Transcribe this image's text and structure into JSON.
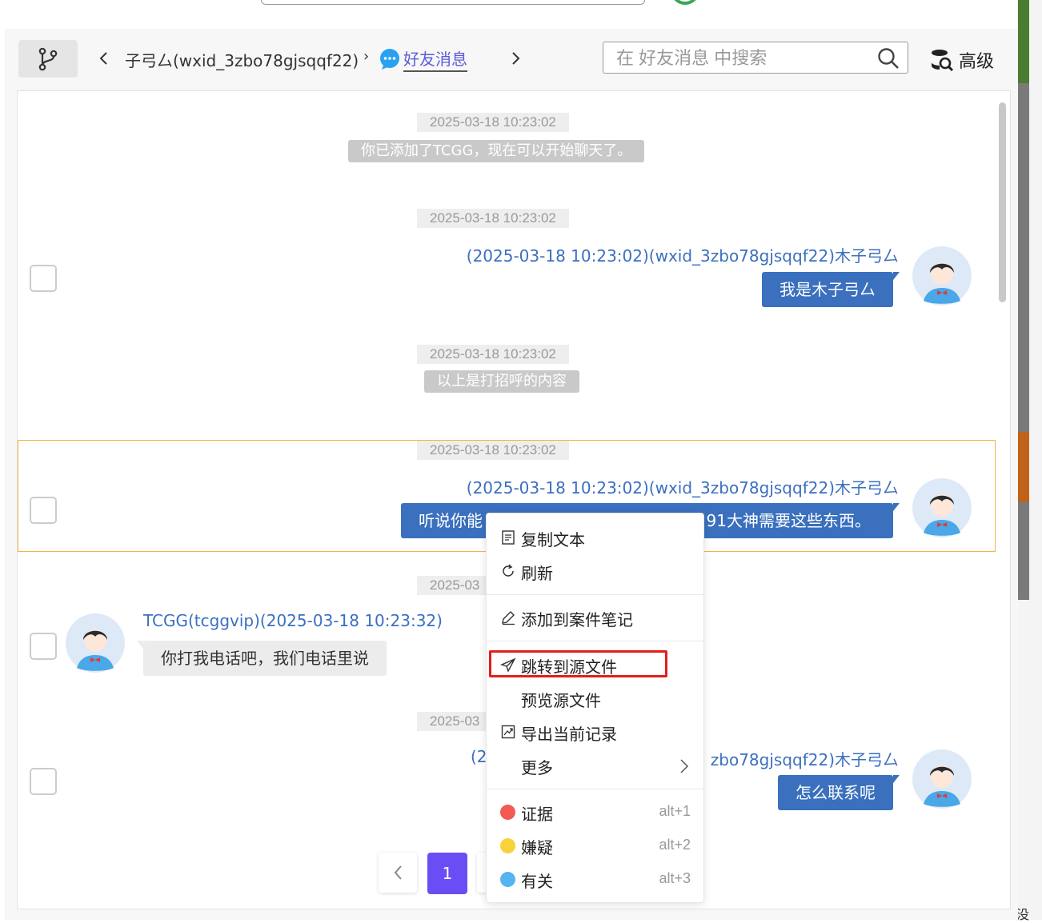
{
  "window": {
    "accent_color": "#6b4df5",
    "highlight_color": "#e51c1c"
  },
  "toolbar": {
    "branch_icon": "branch-icon",
    "breadcrumb_contact": "子弓厶(wxid_3zbo78gjsqqf22)",
    "breadcrumb_separator": "›",
    "breadcrumb_current": "好友消息",
    "search_placeholder": "在 好友消息 中搜索",
    "search_value": "",
    "advanced_label": "高级"
  },
  "messages": [
    {
      "type": "system",
      "time": "2025-03-18 10:23:02",
      "text": "你已添加了TCGG，现在可以开始聊天了。"
    },
    {
      "type": "outgoing",
      "time": "2025-03-18 10:23:02",
      "sender": "(2025-03-18 10:23:02)(wxid_3zbo78gjsqqf22)木子弓厶",
      "text": "我是木子弓厶"
    },
    {
      "type": "system",
      "time": "2025-03-18 10:23:02",
      "text": "以上是打招呼的内容"
    },
    {
      "type": "outgoing",
      "time": "2025-03-18 10:23:02",
      "sender": "(2025-03-18 10:23:02)(wxid_3zbo78gjsqqf22)木子弓厶",
      "text_left": "听说你能",
      "text_right": "91大神需要这些东西。"
    },
    {
      "type": "incoming",
      "time": "2025-03",
      "sender": "TCGG(tcggvip)(2025-03-18 10:23:32)",
      "text": "你打我电话吧，我们电话里说"
    },
    {
      "type": "outgoing",
      "time": "2025-03",
      "sender_left": "(2",
      "sender_right": "zbo78gjsqqf22)木子弓厶",
      "text": "怎么联系呢"
    }
  ],
  "pagination": {
    "current": "1"
  },
  "context_menu": {
    "items": [
      {
        "label": "复制文本",
        "icon": "document-icon"
      },
      {
        "label": "刷新",
        "icon": "refresh-icon"
      },
      {
        "label": "添加到案件笔记",
        "icon": "edit-icon"
      },
      {
        "label": "跳转到源文件",
        "icon": "send-icon"
      },
      {
        "label": "预览源文件"
      },
      {
        "label": "导出当前记录",
        "icon": "export-icon"
      },
      {
        "label": "更多",
        "icon": "chevron-right-icon"
      }
    ],
    "tags": [
      {
        "label": "证据",
        "shortcut": "alt+1",
        "color": "#f25a52"
      },
      {
        "label": "嫌疑",
        "shortcut": "alt+2",
        "color": "#f7d33b"
      },
      {
        "label": "有关",
        "shortcut": "alt+3",
        "color": "#56b4f0"
      }
    ]
  },
  "misc": {
    "right_edge_char": "没"
  }
}
